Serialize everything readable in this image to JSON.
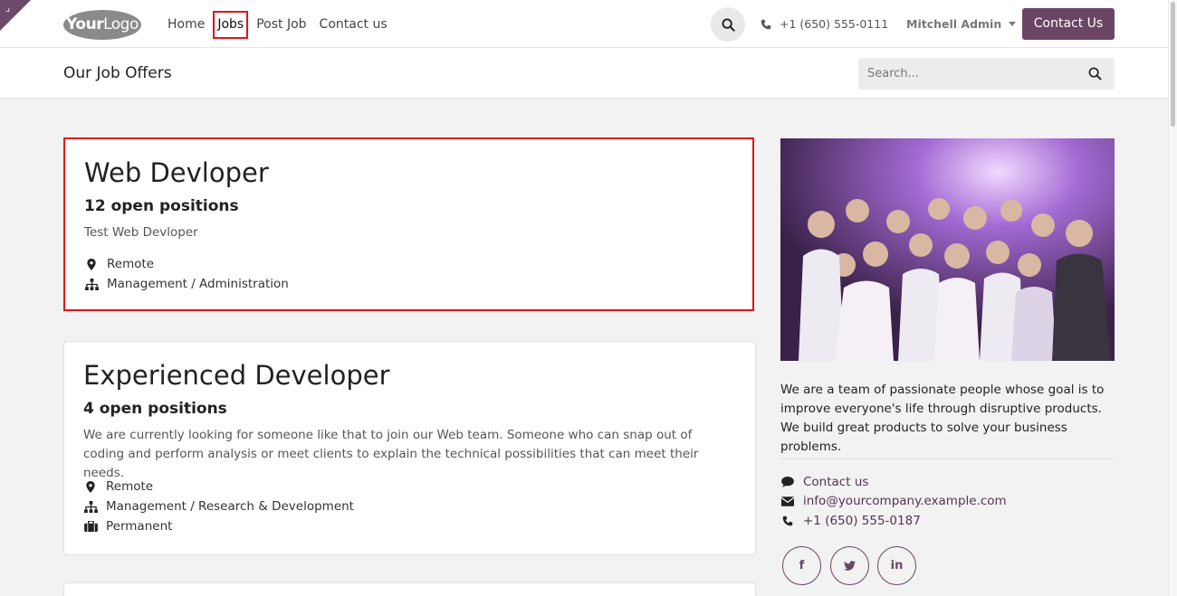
{
  "header": {
    "logo_text_bold": "Your",
    "logo_text_light": "Logo",
    "nav": [
      {
        "label": "Home",
        "active": false
      },
      {
        "label": "Jobs",
        "active": true
      },
      {
        "label": "Post Job",
        "active": false
      },
      {
        "label": "Contact us",
        "active": false
      }
    ],
    "phone": "+1 (650) 555-0111",
    "user": "Mitchell Admin",
    "cta_label": "Contact Us"
  },
  "subheader": {
    "title": "Our Job Offers",
    "search_placeholder": "Search..."
  },
  "jobs": [
    {
      "title": "Web Devloper",
      "count": "12 open positions",
      "description": "Test Web Devloper",
      "location": "Remote",
      "department": "Management / Administration"
    },
    {
      "title": "Experienced Developer",
      "count": "4 open positions",
      "description": "We are currently looking for someone like that to join our Web team. Someone who can snap out of coding and perform analysis or meet clients to explain the technical possibilities that can meet their needs.",
      "location": "Remote",
      "department": "Management / Research & Development",
      "contract": "Permanent"
    }
  ],
  "sidebar": {
    "about": "We are a team of passionate people whose goal is to improve everyone's life through disruptive products. We build great products to solve your business problems.",
    "contact_label": "Contact us",
    "email": "info@yourcompany.example.com",
    "phone": "+1 (650) 555-0187",
    "social": [
      "facebook",
      "twitter",
      "linkedin"
    ]
  },
  "colors": {
    "brand": "#6b4563",
    "highlight": "#e0141b"
  }
}
